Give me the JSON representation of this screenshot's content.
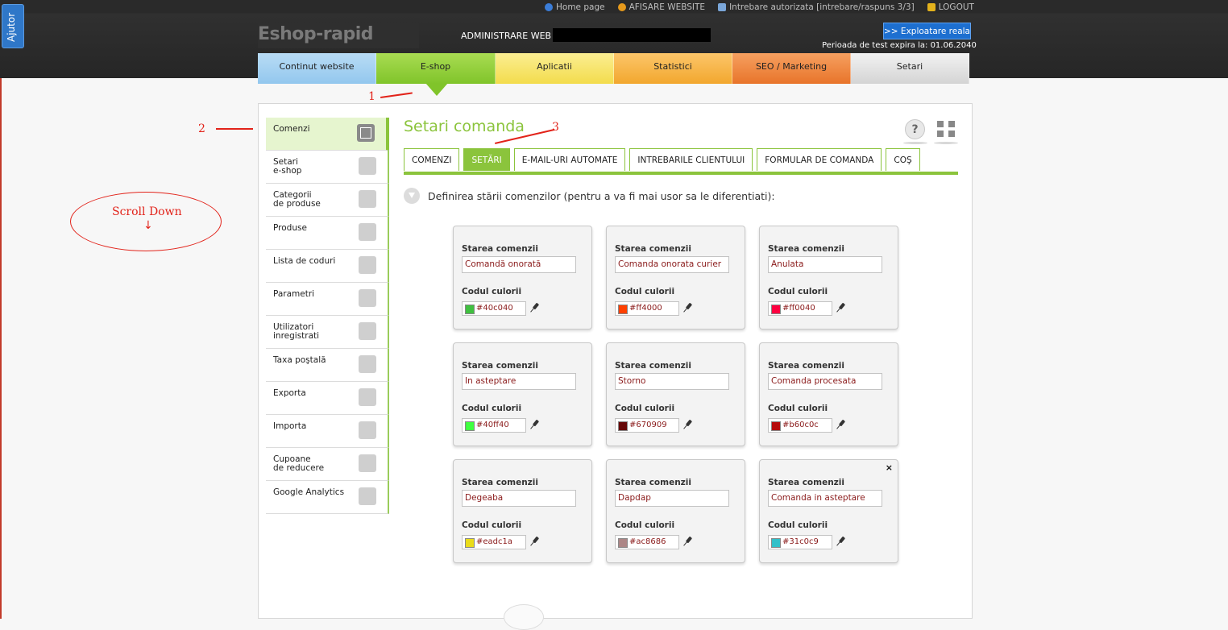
{
  "top_links": [
    {
      "icon": "info-icon",
      "label": "Home page"
    },
    {
      "icon": "sun-icon",
      "label": "AFISARE WEBSITE"
    },
    {
      "icon": "chat-icon",
      "label": "Intrebare autorizata [intrebare/raspuns 3/3]"
    },
    {
      "icon": "lock-icon",
      "label": "LOGOUT"
    }
  ],
  "ajutor": "Ajutor",
  "logo": "Eshop-rapid",
  "admin_label": "ADMINISTRARE WEB :",
  "exploatare_button": ">> Exploatare reala",
  "trial_text": "Perioada de test expira la: 01.06.2040",
  "main_nav": [
    {
      "id": "continut",
      "label": "Continut website",
      "color": "#93c7ee"
    },
    {
      "id": "eshop",
      "label": "E-shop",
      "color": "#80c42a",
      "active": true
    },
    {
      "id": "aplicatii",
      "label": "Aplicatii",
      "color": "#f3dc4c"
    },
    {
      "id": "statistici",
      "label": "Statistici",
      "color": "#f2a72e"
    },
    {
      "id": "seo",
      "label": "SEO / Marketing",
      "color": "#e8742a"
    },
    {
      "id": "setari",
      "label": "Setari",
      "color": "#d4d4d4"
    }
  ],
  "side_menu": [
    {
      "label": "Comenzi",
      "icon": "edit-icon",
      "active": true
    },
    {
      "label": "Setari\ne-shop",
      "icon": "tools-icon"
    },
    {
      "label": "Categorii\nde produse",
      "icon": "box-icon"
    },
    {
      "label": "Produse",
      "icon": "cube-icon"
    },
    {
      "label": "Lista de coduri",
      "icon": "binoculars-icon"
    },
    {
      "label": "Parametri",
      "icon": "sliders-icon"
    },
    {
      "label": "Utilizatori\ninregistrati",
      "icon": "users-icon"
    },
    {
      "label": "Taxa poştală",
      "icon": "truck-icon"
    },
    {
      "label": "Exporta",
      "icon": "upload-icon"
    },
    {
      "label": "Importa",
      "icon": "download-icon"
    },
    {
      "label": "Cupoane\nde reducere",
      "icon": "tag-icon"
    },
    {
      "label": "Google Analytics",
      "icon": "chart-icon"
    }
  ],
  "page_title": "Setari comanda",
  "help_icon": "?",
  "sub_tabs": [
    "COMENZI",
    "SETĂRI",
    "E-MAIL-URI AUTOMATE",
    "INTREBARILE CLIENTULUI",
    "FORMULAR DE COMANDA",
    "COŞ"
  ],
  "active_sub_tab": 1,
  "definition_text": "Definirea stării comenzilor (pentru a va fi mai usor sa le diferentiati):",
  "card_labels": {
    "state": "Starea comenzii",
    "color": "Codul culorii"
  },
  "states": [
    {
      "name": "Comandă onorată",
      "color": "#40c040"
    },
    {
      "name": "Comanda onorata curier",
      "color": "#ff4000"
    },
    {
      "name": "Anulata",
      "color": "#ff0040"
    },
    {
      "name": "In asteptare",
      "color": "#40ff40"
    },
    {
      "name": "Storno",
      "color": "#670909"
    },
    {
      "name": "Comanda procesata",
      "color": "#b60c0c"
    },
    {
      "name": "Degeaba",
      "color": "#eadc1a"
    },
    {
      "name": "Dapdap",
      "color": "#ac8686"
    },
    {
      "name": "Comanda in asteptare",
      "color": "#31c0c9"
    }
  ],
  "close_mark": "×",
  "annotations": {
    "one": "1",
    "two": "2",
    "three": "3",
    "scroll": "Scroll Down",
    "arrow": "↓"
  }
}
